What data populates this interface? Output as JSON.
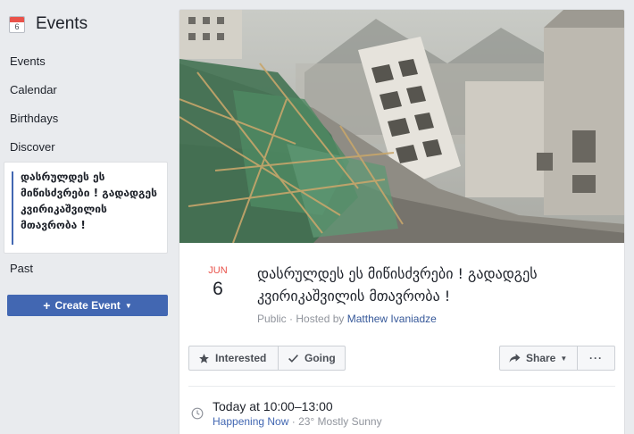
{
  "sidebar": {
    "calendar_icon_day": "6",
    "title": "Events",
    "items": [
      {
        "label": "Events"
      },
      {
        "label": "Calendar"
      },
      {
        "label": "Birthdays"
      },
      {
        "label": "Discover"
      }
    ],
    "selected_event": "დასრულდეს ეს მიწისძვრები ! გადადგეს კვირიკაშვილის მთავრობა !",
    "past_label": "Past",
    "create_event_label": "Create Event"
  },
  "event": {
    "month": "JUN",
    "day": "6",
    "title": "დასრულდეს ეს მიწისძვრები ! გადადგეს კვირიკაშვილის მთავრობა !",
    "privacy": "Public",
    "hosted_by_prefix": "Hosted by",
    "host": "Matthew Ivaniadze",
    "buttons": {
      "interested": "Interested",
      "going": "Going",
      "share": "Share",
      "more": "···"
    },
    "time": "Today at 10:00–13:00",
    "status": "Happening Now",
    "weather": "23° Mostly Sunny"
  },
  "colors": {
    "accent": "#4267b2",
    "date_red": "#e9524a",
    "link": "#365899"
  }
}
